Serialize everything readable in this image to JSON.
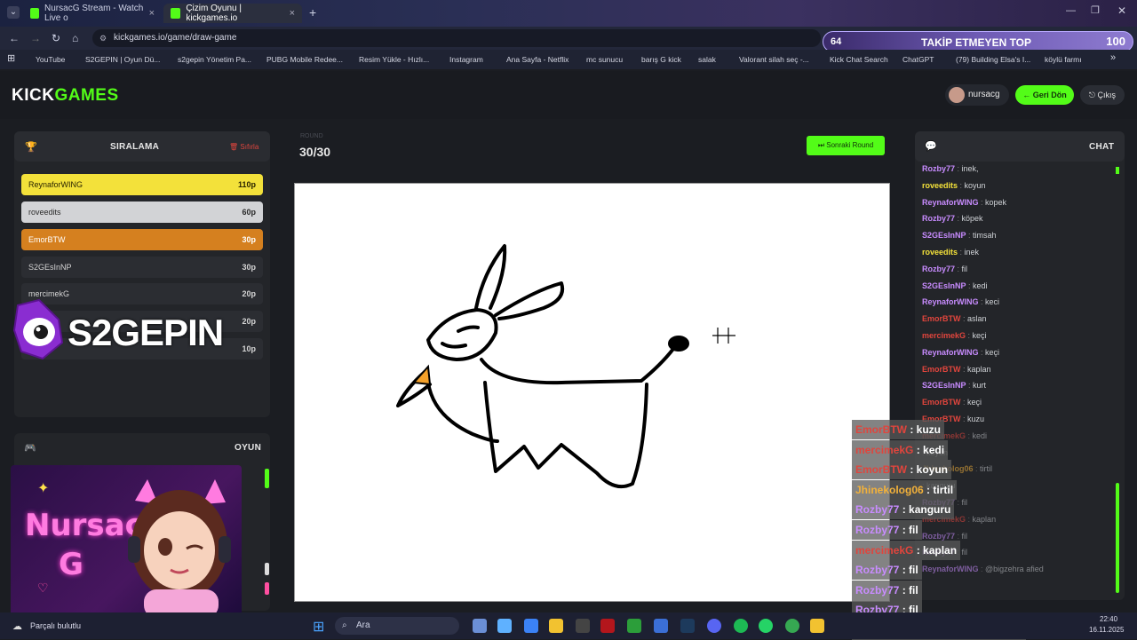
{
  "browser": {
    "tabs": [
      {
        "title": "NursacG Stream - Watch Live o"
      },
      {
        "title": "Çizim Oyunu | kickgames.io"
      }
    ],
    "url": "kickgames.io/game/draw-game",
    "bookmarks": [
      "YouTube",
      "S2GEPIN | Oyun Dü...",
      "s2gepin Yönetim Pa...",
      "PUBG Mobile Redee...",
      "Resim Yükle - Hızlı...",
      "Instagram",
      "Ana Sayfa - Netflix",
      "mc sunucu",
      "barış G kick",
      "salak",
      "Valorant silah seç -...",
      "Kick Chat Search",
      "ChatGPT",
      "(79) Building Elsa's I...",
      "köylü farmı"
    ]
  },
  "follow_overlay": {
    "count": "64",
    "title": "TAKİP ETMEYEN TOP",
    "right": "100"
  },
  "header": {
    "logo_a": "KICK",
    "logo_b": "GAMES",
    "user": "nursacg",
    "back": "← Geri Dön",
    "logout": "Çıkış"
  },
  "ranking": {
    "title": "SIRALAMA",
    "reset": "Sıfırla",
    "rows": [
      {
        "name": "ReynaforWING",
        "points": "110p"
      },
      {
        "name": "roveedits",
        "points": "60p"
      },
      {
        "name": "EmorBTW",
        "points": "30p"
      },
      {
        "name": "S2GEsInNP",
        "points": "30p"
      },
      {
        "name": "mercimekG",
        "points": "20p"
      },
      {
        "name": "",
        "points": "20p"
      },
      {
        "name": "",
        "points": "10p"
      }
    ]
  },
  "brand_overlay": "S2GEPIN",
  "game_panel": {
    "title": "OYUN"
  },
  "round": {
    "label": "ROUND",
    "value": "30/30",
    "next": "Sonraki Round"
  },
  "stream_card": {
    "line1": "Nursaç",
    "line2": "G"
  },
  "chat": {
    "title": "CHAT",
    "messages": [
      {
        "user": "Rozby77",
        "text": "inek,",
        "color": "#c88cff"
      },
      {
        "user": "roveedits",
        "text": "koyun",
        "color": "#f4e23a"
      },
      {
        "user": "ReynaforWING",
        "text": "kopek",
        "color": "#c88cff"
      },
      {
        "user": "Rozby77",
        "text": "köpek",
        "color": "#c88cff"
      },
      {
        "user": "S2GEsInNP",
        "text": "timsah",
        "color": "#c88cff"
      },
      {
        "user": "roveedits",
        "text": "inek",
        "color": "#f4e23a"
      },
      {
        "user": "Rozby77",
        "text": "fil",
        "color": "#c88cff"
      },
      {
        "user": "S2GEsInNP",
        "text": "kedi",
        "color": "#c88cff"
      },
      {
        "user": "ReynaforWING",
        "text": "keci",
        "color": "#c88cff"
      },
      {
        "user": "EmorBTW",
        "text": "aslan",
        "color": "#e0453d"
      },
      {
        "user": "mercimekG",
        "text": "keçi",
        "color": "#e0453d"
      },
      {
        "user": "ReynaforWING",
        "text": "keçi",
        "color": "#c88cff"
      },
      {
        "user": "EmorBTW",
        "text": "kaplan",
        "color": "#e0453d"
      },
      {
        "user": "S2GEsInNP",
        "text": "kurt",
        "color": "#c88cff"
      },
      {
        "user": "EmorBTW",
        "text": "keçi",
        "color": "#e0453d"
      },
      {
        "user": "EmorBTW",
        "text": "kuzu",
        "color": "#e0453d"
      },
      {
        "user": "mercimekG",
        "text": "kedi",
        "color": "#e0453d"
      },
      {
        "user": "",
        "text": "koyun",
        "color": "#e0453d"
      },
      {
        "user": "Jhinekolog06",
        "text": "tirtil",
        "color": "#f2b13a"
      },
      {
        "user": "",
        "text": "kanguru",
        "color": "#c88cff"
      },
      {
        "user": "Rozby77",
        "text": "fil",
        "color": "#c88cff"
      },
      {
        "user": "mercimekG",
        "text": "kaplan",
        "color": "#e0453d"
      },
      {
        "user": "Rozby77",
        "text": "fil",
        "color": "#c88cff"
      },
      {
        "user": "Rozby77",
        "text": "fil",
        "color": "#c88cff"
      },
      {
        "user": "ReynaforWING",
        "text": "@bigzehra afied",
        "color": "#c88cff"
      }
    ]
  },
  "stream_chat_overlay": [
    {
      "user": "EmorBTW",
      "text": "kuzu",
      "color": "#e0453d"
    },
    {
      "user": "mercimekG",
      "text": "kedi",
      "color": "#e0453d"
    },
    {
      "user": "EmorBTW",
      "text": "koyun",
      "color": "#e0453d"
    },
    {
      "user": "Jhinekolog06",
      "text": "tirtil",
      "color": "#f2b13a"
    },
    {
      "user": "Rozby77",
      "text": "kanguru",
      "color": "#c88cff"
    },
    {
      "user": "Rozby77",
      "text": "fil",
      "color": "#c88cff"
    },
    {
      "user": "mercimekG",
      "text": "kaplan",
      "color": "#e0453d"
    },
    {
      "user": "Rozby77",
      "text": "fil",
      "color": "#c88cff"
    },
    {
      "user": "Rozby77",
      "text": "fil",
      "color": "#c88cff"
    },
    {
      "user": "Rozby77",
      "text": "fil",
      "color": "#c88cff"
    },
    {
      "user": "ReynaforWING",
      "text": "@bigzehra afied",
      "color": "#c88cff"
    }
  ],
  "taskbar": {
    "weather": "Parçalı bulutlu",
    "search": "Ara",
    "time": "22:40",
    "date": "16.11.2025"
  }
}
